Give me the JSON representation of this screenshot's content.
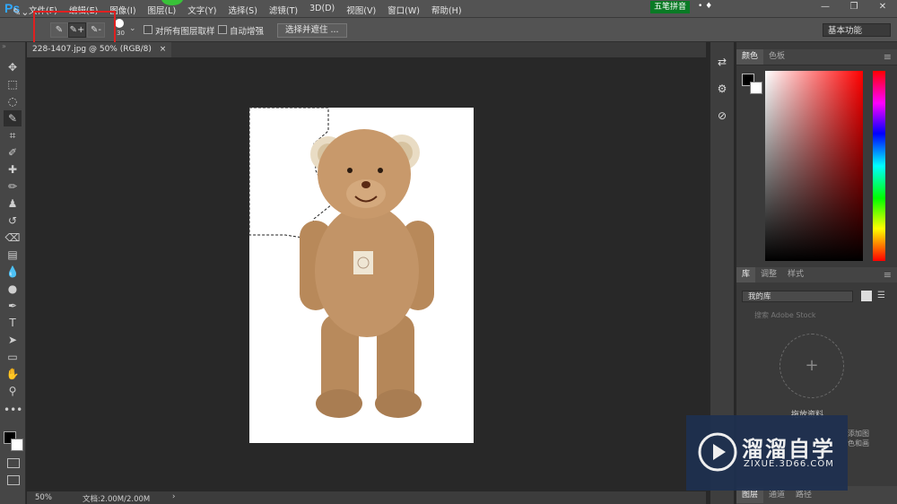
{
  "app": {
    "logo": "Ps"
  },
  "menubar": {
    "items": [
      "文件(F)",
      "编辑(E)",
      "图像(I)",
      "图层(L)",
      "文字(Y)",
      "选择(S)",
      "滤镜(T)",
      "3D(D)",
      "视图(V)",
      "窗口(W)",
      "帮助(H)"
    ],
    "ime_label": "五笔拼音",
    "ime_icons": "• ♦"
  },
  "window_controls": {
    "minimize": "—",
    "restore": "❐",
    "close": "✕"
  },
  "options": {
    "tool_preset": "✎⌄",
    "mode_buttons": [
      "✎",
      "✎+",
      "✎-"
    ],
    "brush_size": "30",
    "sample_all_layers": "对所有图层取样",
    "auto_enhance": "自动增强",
    "refine_button": "选择并遮住 ...",
    "workspace": "基本功能"
  },
  "document": {
    "tab_title": "228-1407.jpg @ 50% (RGB/8)",
    "tab_close": "×",
    "zoom": "50%",
    "doc_info": "文档:2.00M/2.00M"
  },
  "tools": [
    {
      "name": "move-tool",
      "glyph": "✥"
    },
    {
      "name": "marquee-tool",
      "glyph": "⬚"
    },
    {
      "name": "lasso-tool",
      "glyph": "◌"
    },
    {
      "name": "quick-selection-tool",
      "glyph": "✎"
    },
    {
      "name": "crop-tool",
      "glyph": "⌗"
    },
    {
      "name": "eyedropper-tool",
      "glyph": "✐"
    },
    {
      "name": "healing-brush-tool",
      "glyph": "✚"
    },
    {
      "name": "brush-tool",
      "glyph": "✏"
    },
    {
      "name": "clone-stamp-tool",
      "glyph": "♟"
    },
    {
      "name": "history-brush-tool",
      "glyph": "↺"
    },
    {
      "name": "eraser-tool",
      "glyph": "⌫"
    },
    {
      "name": "gradient-tool",
      "glyph": "▤"
    },
    {
      "name": "blur-tool",
      "glyph": "💧"
    },
    {
      "name": "dodge-tool",
      "glyph": "●"
    },
    {
      "name": "pen-tool",
      "glyph": "✒"
    },
    {
      "name": "type-tool",
      "glyph": "T"
    },
    {
      "name": "path-selection-tool",
      "glyph": "➤"
    },
    {
      "name": "rectangle-tool",
      "glyph": "▭"
    },
    {
      "name": "hand-tool",
      "glyph": "✋"
    },
    {
      "name": "zoom-tool",
      "glyph": "⚲"
    },
    {
      "name": "more-tools",
      "glyph": "•••"
    }
  ],
  "colors_panel": {
    "tabs": [
      "颜色",
      "色板"
    ],
    "accent": "#31a8ff"
  },
  "library_panel": {
    "tabs": [
      "库",
      "调整",
      "样式"
    ],
    "library_select": "我的库",
    "search_placeholder": "搜索 Adobe Stock",
    "drop_plus": "+",
    "drop_text": "拖放资料",
    "hint1": "添加图",
    "hint2": "色和画"
  },
  "bottom_panel": {
    "tabs": [
      "图层",
      "通道",
      "路径"
    ]
  },
  "watermark": {
    "brand": "溜溜自学",
    "url": "ZIXUE.3D66.COM"
  }
}
